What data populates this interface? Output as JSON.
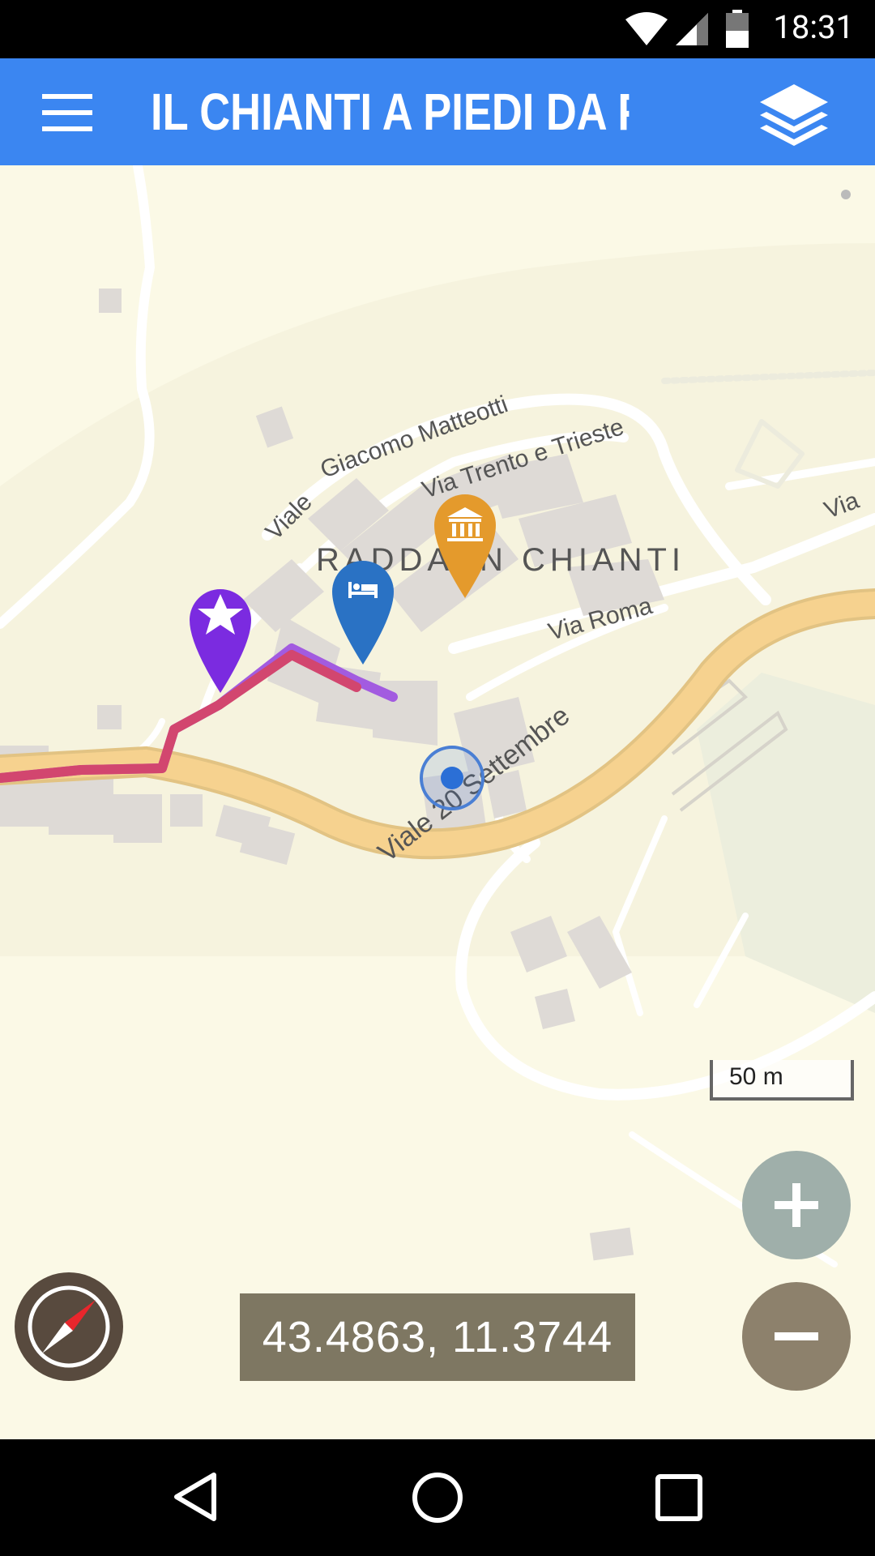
{
  "status_bar": {
    "time": "18:31"
  },
  "app_bar": {
    "title": "IL CHIANTI A PIEDI DA FIRE..."
  },
  "map": {
    "town_label": "RADDA IN CHIANTI",
    "streets": [
      "Viale Giacomo Matteotti",
      "Via Trento e Trieste",
      "Via Roma",
      "Viale 20 Settembre",
      "Via"
    ],
    "markers": [
      {
        "name": "star-poi",
        "color": "#7b2be0",
        "icon": "star-icon"
      },
      {
        "name": "hotel-poi",
        "color": "#2a72c4",
        "icon": "bed-icon"
      },
      {
        "name": "museum-poi",
        "color": "#e49a2c",
        "icon": "museum-icon"
      }
    ],
    "route_colors": {
      "track": "#d2466f",
      "leg": "#a25be0"
    }
  },
  "scale_bar": {
    "label": "50 m"
  },
  "coordinates": {
    "text": "43.4863, 11.3744"
  }
}
